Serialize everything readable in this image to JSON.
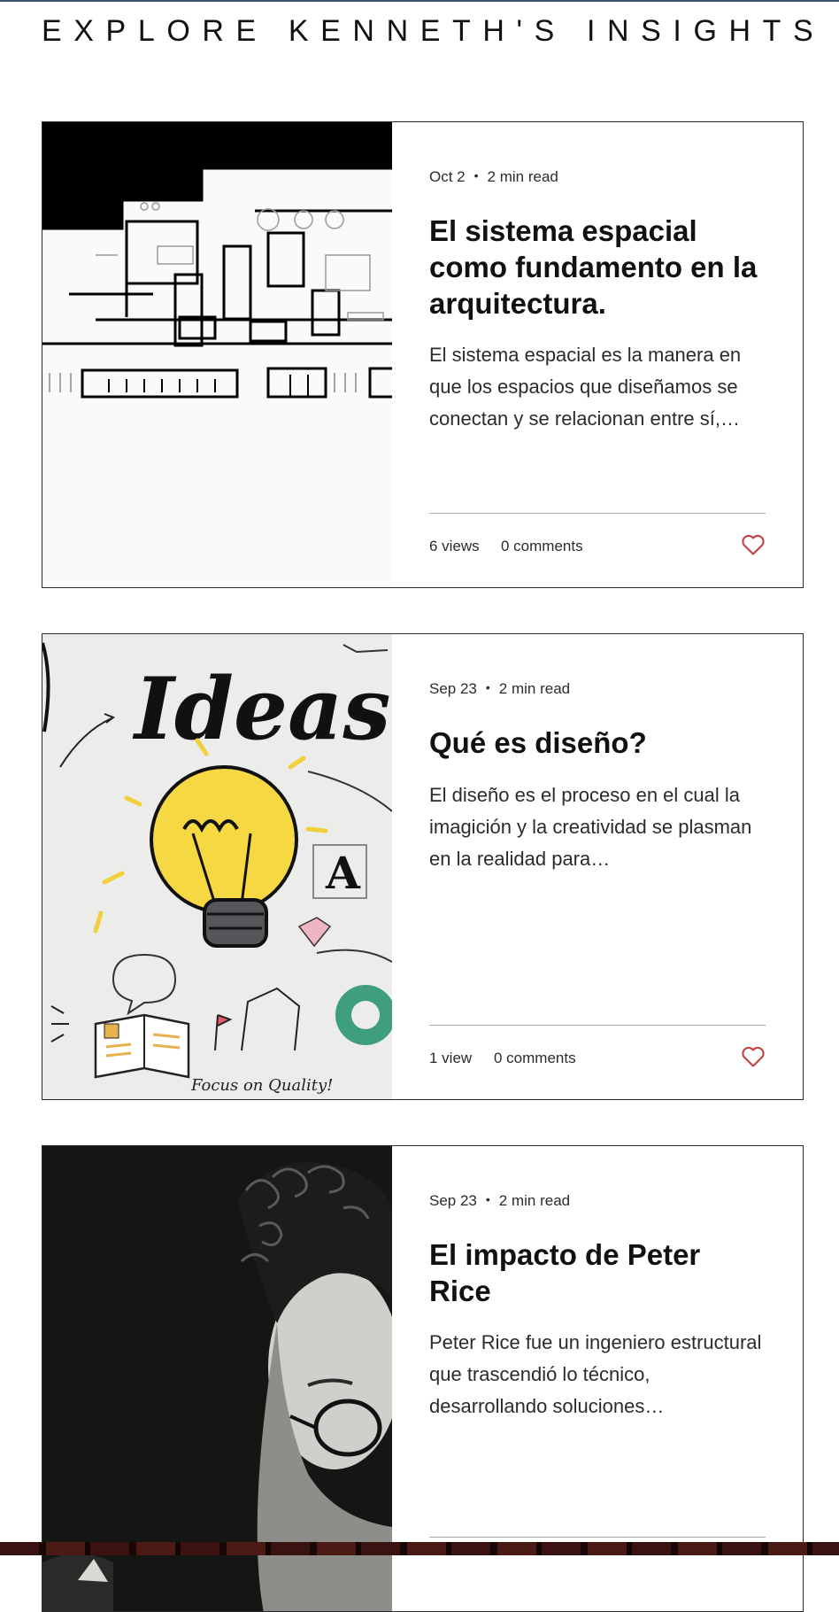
{
  "page": {
    "title": "EXPLORE KENNETH'S INSIGHTS"
  },
  "posts": [
    {
      "date": "Oct 2",
      "read_time": "2 min read",
      "title": "El sistema espacial como fundamento en la arquitectura.",
      "excerpt": "El sistema espacial es la manera en que los espacios que diseñamos se conectan y se relacionan entre sí,…",
      "views": "6 views",
      "comments": "0 comments",
      "image_icon": "floor-plan-image"
    },
    {
      "date": "Sep 23",
      "read_time": "2 min read",
      "title": "Qué es diseño?",
      "excerpt": "El diseño es el proceso en el cual la imagición y la creatividad se plasman en la realidad para…",
      "views": "1 view",
      "comments": "0 comments",
      "image_icon": "ideas-lightbulb-image",
      "image_text": [
        "Ideas",
        "A",
        "Focus on Quality!"
      ]
    },
    {
      "date": "Sep 23",
      "read_time": "2 min read",
      "title": "El impacto de Peter Rice",
      "excerpt": "Peter Rice fue un ingeniero estructural que trascendió lo técnico, desarrollando soluciones…",
      "views": "",
      "comments": "",
      "image_icon": "portrait-photo-image"
    }
  ],
  "colors": {
    "heart": "#c0403f",
    "divider": "#a9a9a9",
    "border": "#2a2a2a",
    "text": "#2b2b2b"
  }
}
